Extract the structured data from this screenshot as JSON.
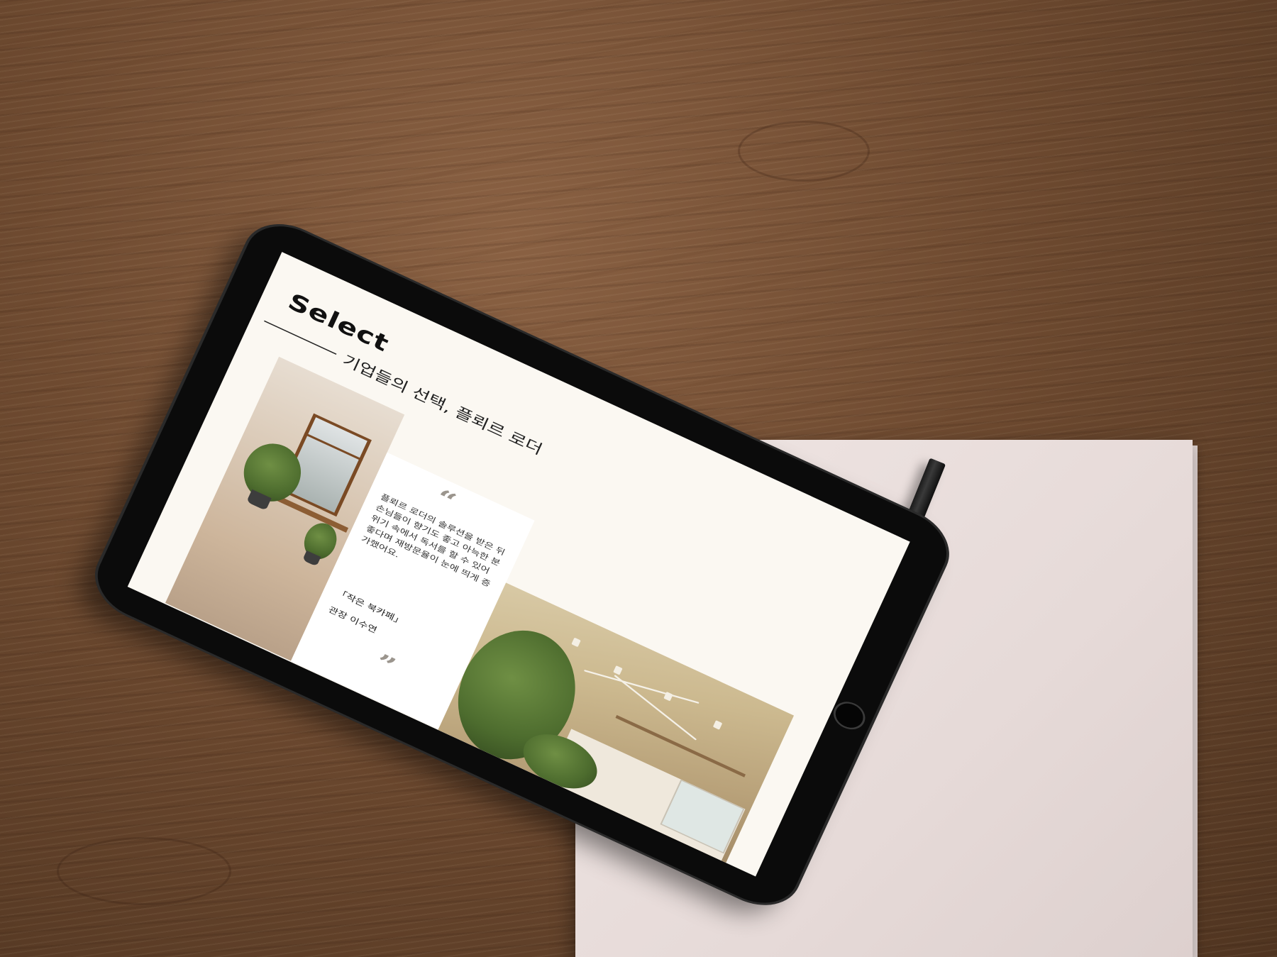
{
  "slide": {
    "title": "Select",
    "subtitle": "기업들의 선택, 플뢰르 로더",
    "quote": {
      "open_mark": "“",
      "close_mark": "”",
      "body": "플뢰르 로더의 솔루션을 받은 뒤 손님들이 향기도 좋고 아늑한 분위기 속에서 독서를 할 수 있어 좋다며 재방문율이 눈에 띄게 증가했어요.",
      "source_line1": "「작은 북카페」",
      "source_line2": "관장 이수연"
    }
  },
  "icons": {
    "home_button": "home-button-icon"
  },
  "colors": {
    "screen_background": "#fbf8f2",
    "tablet_bezel": "#0b0b0b",
    "paper": "#e8dcda",
    "wood": "#6e4a30"
  }
}
